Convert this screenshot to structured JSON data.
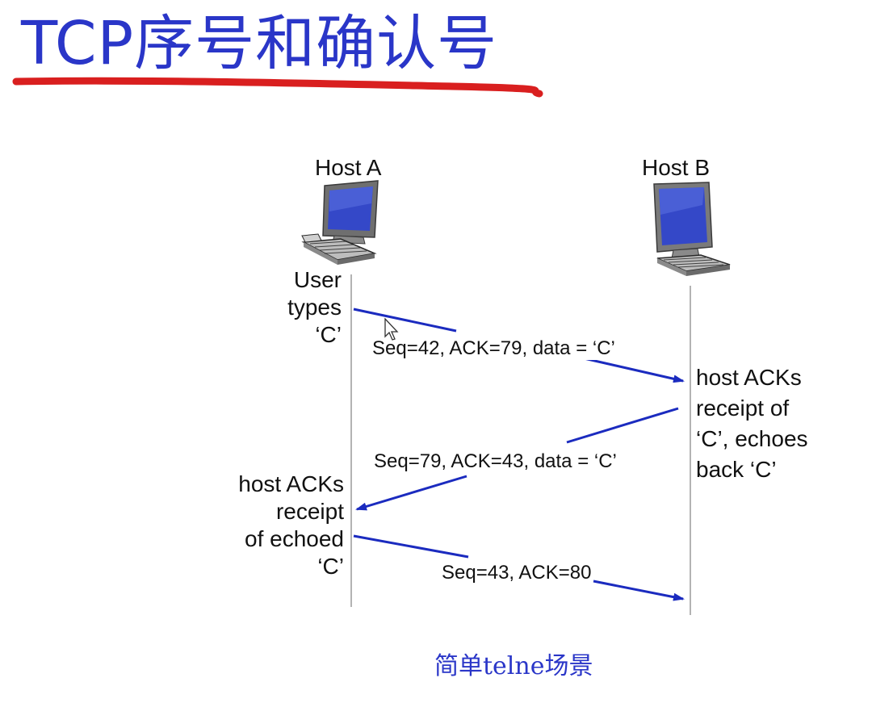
{
  "title": "TCP序号和确认号",
  "colors": {
    "title": "#2a36c8",
    "underline": "#d91f1f",
    "arrow": "#1b2bbf",
    "timeline": "#9a9a9a",
    "caption": "#2a36c8"
  },
  "hosts": {
    "a": {
      "label": "Host A",
      "icon": "computer-icon"
    },
    "b": {
      "label": "Host B",
      "icon": "computer-icon"
    }
  },
  "notes": {
    "user_types": [
      "User",
      "types",
      "‘C’"
    ],
    "host_b_ack": [
      "host ACKs",
      "receipt of",
      "‘C’, echoes",
      "back ‘C’"
    ],
    "host_a_ack": [
      "host ACKs",
      "receipt",
      "of echoed",
      "‘C’"
    ]
  },
  "segments": [
    {
      "label": "Seq=42, ACK=79, data = ‘C’",
      "direction": "A to B"
    },
    {
      "label": "Seq=79, ACK=43, data = ‘C’",
      "direction": "B to A"
    },
    {
      "label": "Seq=43, ACK=80",
      "direction": "A to B"
    }
  ],
  "caption": "简单telne场景"
}
